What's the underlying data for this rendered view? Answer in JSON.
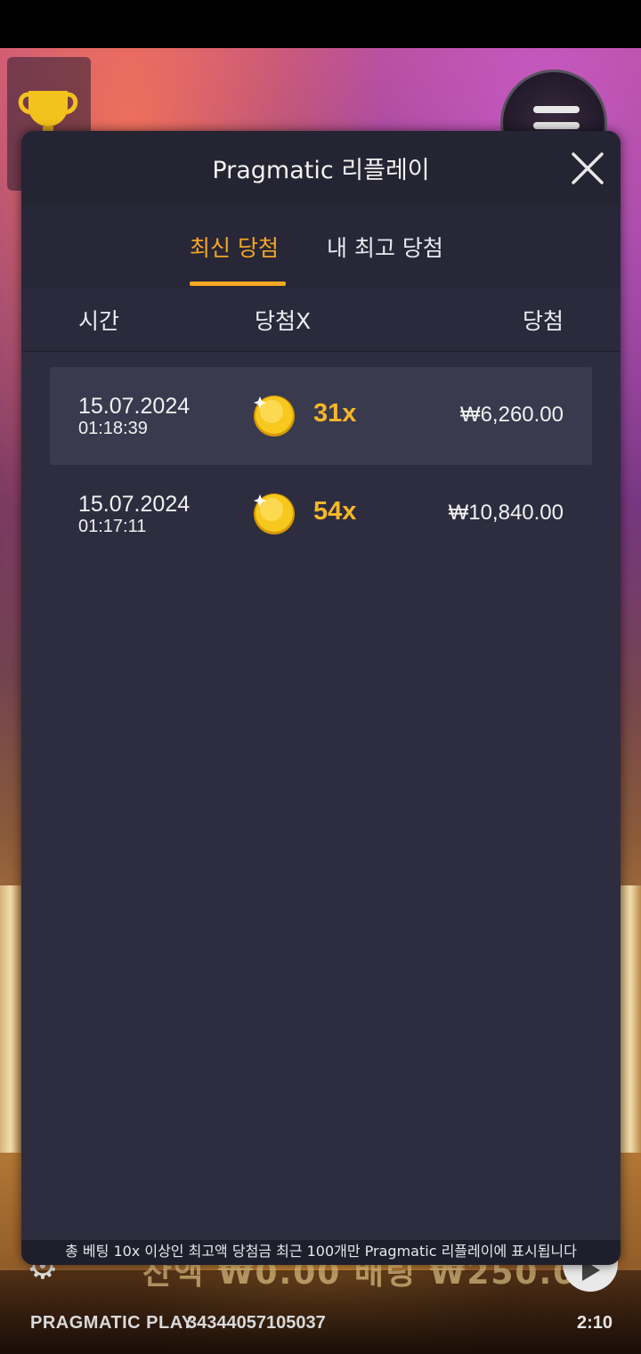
{
  "modal": {
    "title": "Pragmatic 리플레이",
    "tabs": [
      {
        "label": "최신 당첨",
        "active": true
      },
      {
        "label": "내 최고 당첨",
        "active": false
      }
    ],
    "columns": {
      "time": "시간",
      "multiplier": "당첨X",
      "win": "당첨"
    },
    "rows": [
      {
        "date": "15.07.2024",
        "time": "01:18:39",
        "multiplier": "31x",
        "win": "₩6,260.00"
      },
      {
        "date": "15.07.2024",
        "time": "01:17:11",
        "multiplier": "54x",
        "win": "₩10,840.00"
      }
    ],
    "footnote": "총 베팅 10x 이상인 최고액 당첨금 최근 100개만 Pragmatic 리플레이에 표시됩니다"
  },
  "game": {
    "brand": "PRAGMATIC PLAY",
    "session_id": "34344057105037",
    "clock": "2:10",
    "obscured_balance": "잔액 ₩0.00   배팅 ₩250.00"
  },
  "colors": {
    "accent": "#f5a623",
    "modal_bg": "#2d2d3f",
    "header_bg": "#242433",
    "row_highlight": "#393a4e",
    "multiplier": "#f6b627"
  },
  "icons": {
    "close": "close-icon",
    "trophy": "trophy-icon",
    "menu": "hamburger-menu-icon",
    "coin": "gold-coin-icon",
    "settings": "gear-icon",
    "play": "play-icon"
  }
}
